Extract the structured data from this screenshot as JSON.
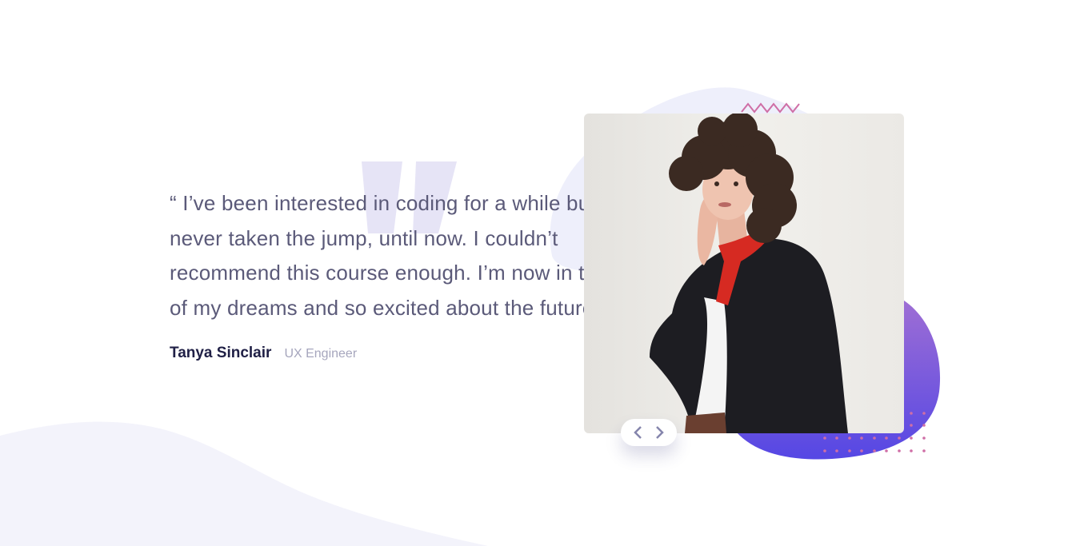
{
  "testimonial": {
    "quote": "“ I’ve been interested in coding for a while but never taken the jump, until now. I couldn’t recommend this course enough. I’m now in the job of my dreams and so excited about the future. ”",
    "author_name": "Tanya Sinclair",
    "author_role": "UX Engineer"
  },
  "photo": {
    "alt": "Tanya Sinclair"
  },
  "controls": {
    "prev_icon": "chevron-left-icon",
    "next_icon": "chevron-right-icon"
  },
  "colors": {
    "text": "#5b5a79",
    "name": "#202046",
    "role": "#a6a6bd",
    "quote_mark": "#e6e4f6",
    "blob_light": "#eeeffb",
    "blob_top": "#9a6cd6",
    "blob_bottom": "#5547e4",
    "accent_pink": "#cf6ea6"
  }
}
